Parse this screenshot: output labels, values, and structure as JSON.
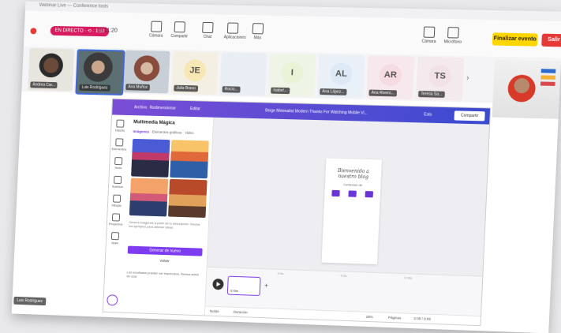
{
  "toolbar": {
    "live_label": "EN DIRECTO · ⟲ · 1:50",
    "timer": "0:11:20",
    "tools": [
      "Cámara",
      "Compartir",
      "Chat",
      "Aplicaciones",
      "Más",
      "Cámara",
      "Micrófono"
    ],
    "finish_label": "Finalizar evento",
    "exit_label": "Salir"
  },
  "participants": [
    {
      "name": "Andrea Car...",
      "type": "photo"
    },
    {
      "name": "Luis Rodríguez",
      "type": "photo"
    },
    {
      "name": "Ana Muñoz",
      "type": "photo"
    },
    {
      "name": "Julia Bravo",
      "initials": "JE",
      "color": "#f7e7b4"
    },
    {
      "name": "Rocío...",
      "initials": "",
      "color": "#e8eef6"
    },
    {
      "name": "Isabel...",
      "initials": "I",
      "color": "#e8f3d8"
    },
    {
      "name": "Ana López...",
      "initials": "AL",
      "color": "#dde9f7"
    },
    {
      "name": "Ana Rivero...",
      "initials": "AR",
      "color": "#f7dbe2"
    },
    {
      "name": "Teresa Sa...",
      "initials": "TS",
      "color": "#f2e2e8"
    }
  ],
  "canva": {
    "topbar_items": [
      "Archivo",
      "Redimensionar",
      "Editar"
    ],
    "doc_title": "Beige Minimalist Modern Thanks For Watching Mobile Vi...",
    "present_label": "Esto",
    "share_label": "Compartir",
    "rail": [
      "Diseño",
      "Elementos",
      "Texto",
      "Subidos",
      "Dibujar",
      "Proyectos",
      "Apps"
    ],
    "panel_title": "Multimedia Mágica",
    "panel_tabs": [
      "Imágenes",
      "Elementos gráficos",
      "Video"
    ],
    "panel_text": "Genera imágenes a partir de tu descripción. Revisa los ejemplos para obtener ideas.",
    "generate_button": "Generar de nuevo",
    "back_label": "Volver",
    "panel_footer": "Los resultados pueden ser imprecisos. Revisa antes de usar.",
    "page_title": "Bienvenido a nuestro blog",
    "page_sub": "Contenido de",
    "timeline_ticks": [
      "0:0s",
      "0:5s",
      "0:10s"
    ],
    "clip_label": "0:09s",
    "status_left": "Notas",
    "status_mid": "Duración",
    "status_zoom": "28%",
    "status_pages": "Páginas",
    "status_right": "2:08 / 0:09"
  },
  "presenter_name": "Luis Rodríguez",
  "window_title": "Webinar Live — Conference tools"
}
